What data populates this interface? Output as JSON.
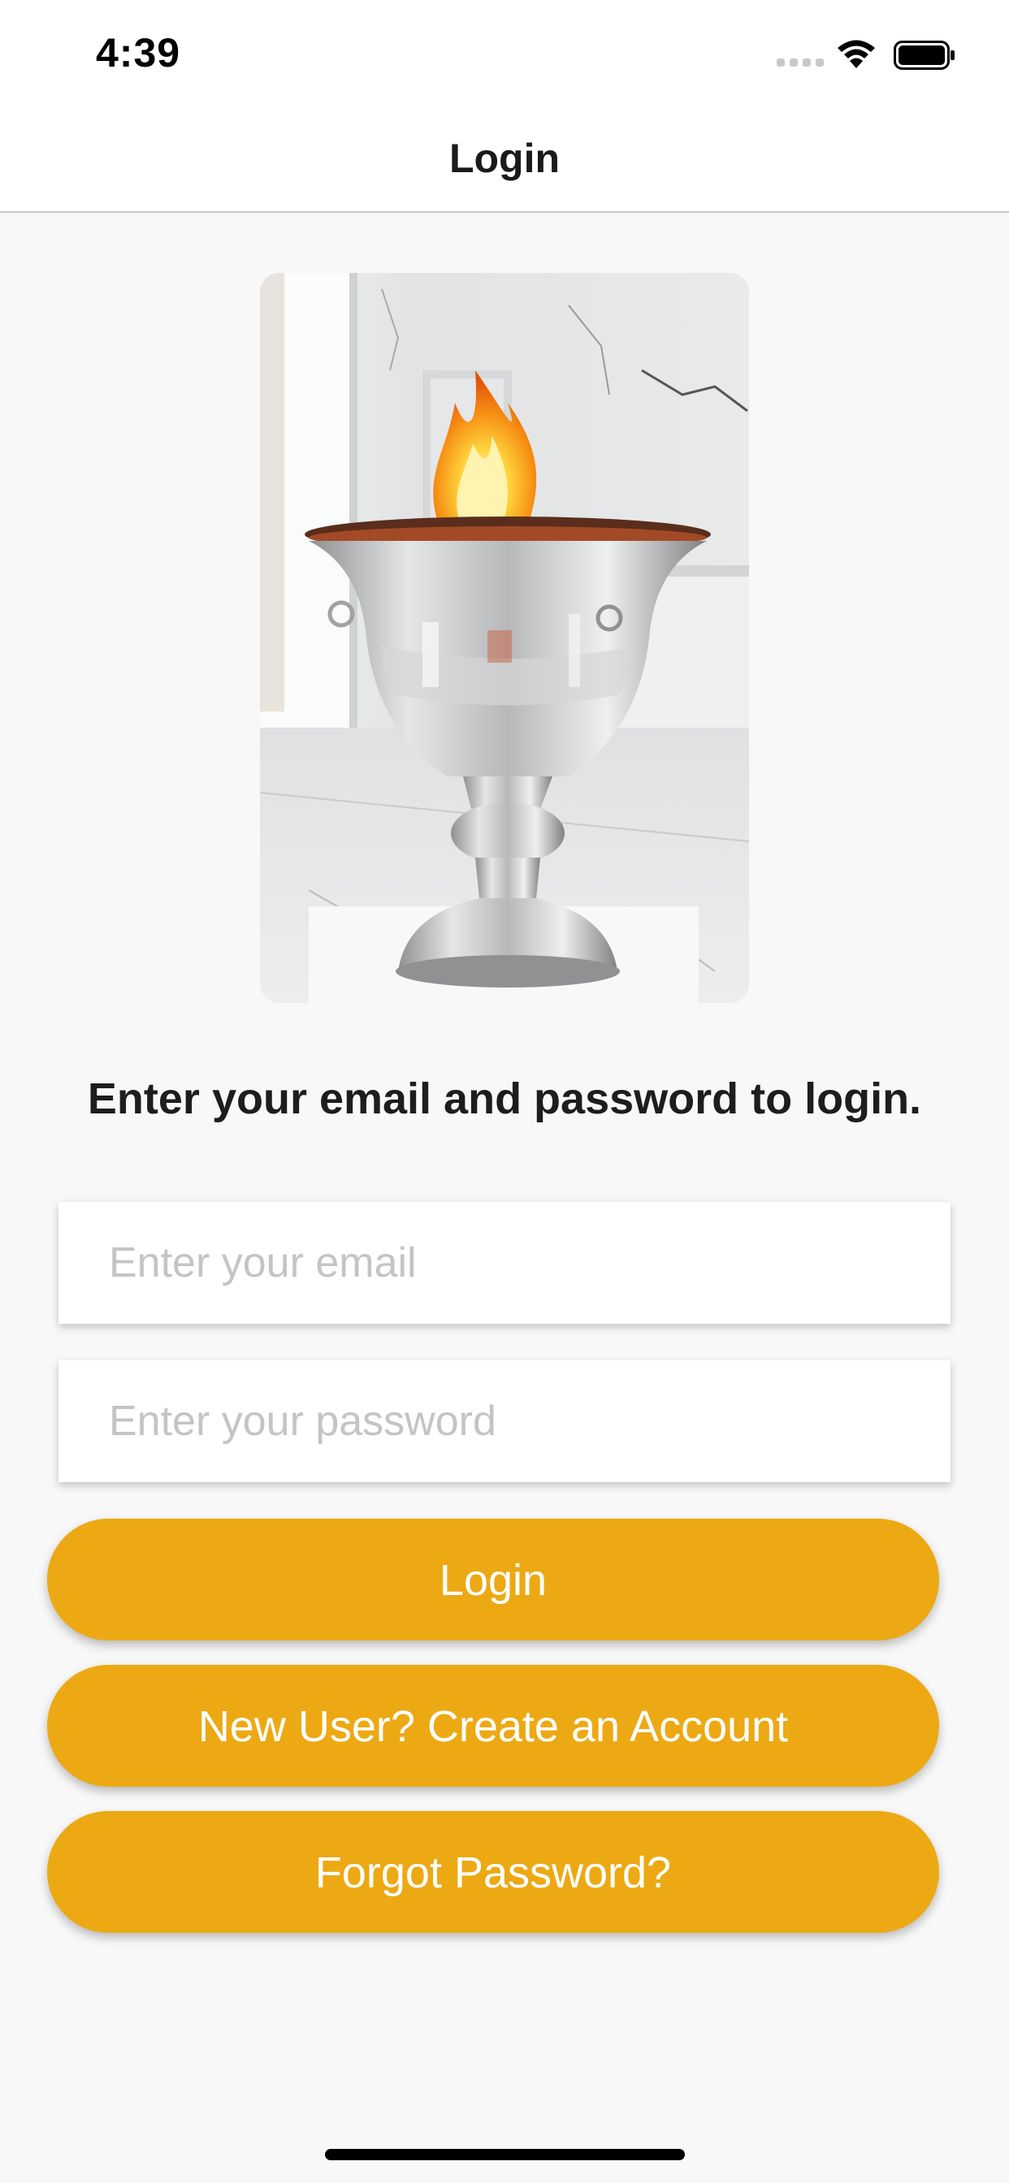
{
  "status_bar": {
    "time": "4:39",
    "icons": [
      "cellular-signal-icon",
      "wifi-icon",
      "battery-icon"
    ]
  },
  "nav": {
    "title": "Login"
  },
  "hero": {
    "image": "silver-fire-urn-photo"
  },
  "instruction": "Enter your email and password to login.",
  "form": {
    "email_placeholder": "Enter your email",
    "email_value": "",
    "password_placeholder": "Enter your password",
    "password_value": ""
  },
  "buttons": {
    "login": "Login",
    "create_account": "New User? Create an Account",
    "forgot_password": "Forgot Password?"
  },
  "colors": {
    "accent": "#eca913",
    "background": "#f8f8f8",
    "button_text": "#ffffff",
    "placeholder": "#c4c4c4"
  }
}
